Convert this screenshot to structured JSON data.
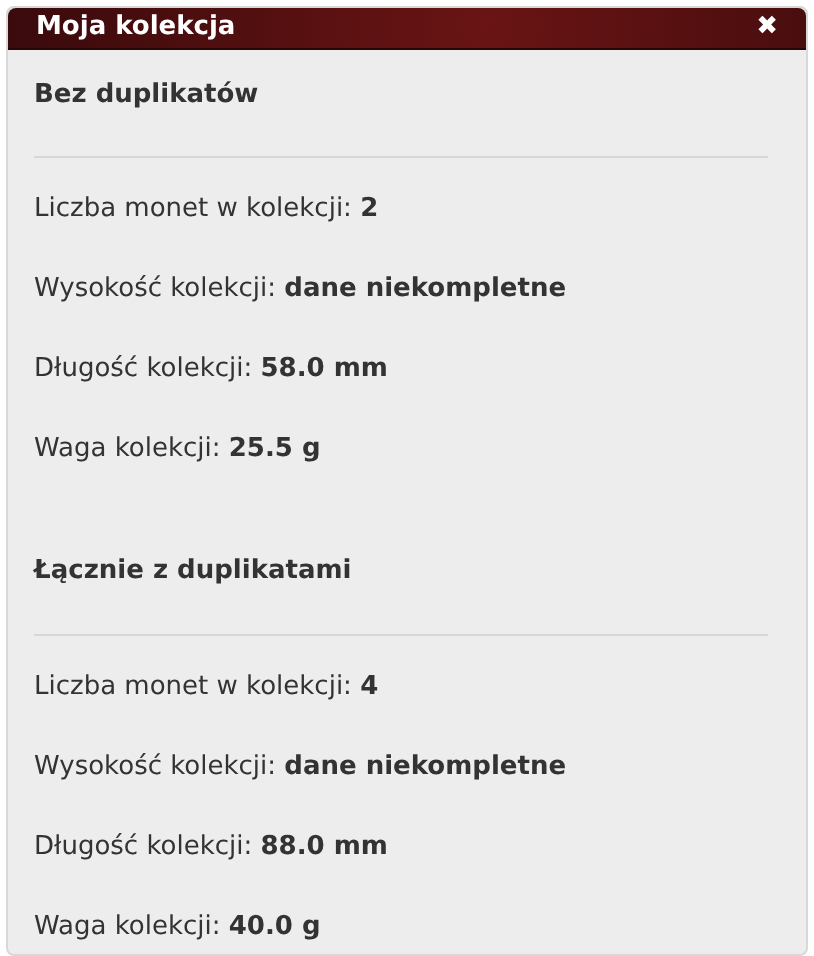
{
  "window": {
    "title": "Moja kolekcja",
    "close": "✖"
  },
  "sections": [
    {
      "title": "Bez duplikatów",
      "rows": [
        {
          "label": "Liczba monet w kolekcji:",
          "value": "2"
        },
        {
          "label": "Wysokość kolekcji:",
          "value": "dane niekompletne"
        },
        {
          "label": "Długość kolekcji:",
          "value": "58.0 mm"
        },
        {
          "label": "Waga kolekcji:",
          "value": "25.5 g"
        }
      ]
    },
    {
      "title": "Łącznie z duplikatami",
      "rows": [
        {
          "label": "Liczba monet w kolekcji:",
          "value": "4"
        },
        {
          "label": "Wysokość kolekcji:",
          "value": "dane niekompletne"
        },
        {
          "label": "Długość kolekcji:",
          "value": "88.0 mm"
        },
        {
          "label": "Waga kolekcji:",
          "value": "40.0 g"
        }
      ]
    }
  ]
}
